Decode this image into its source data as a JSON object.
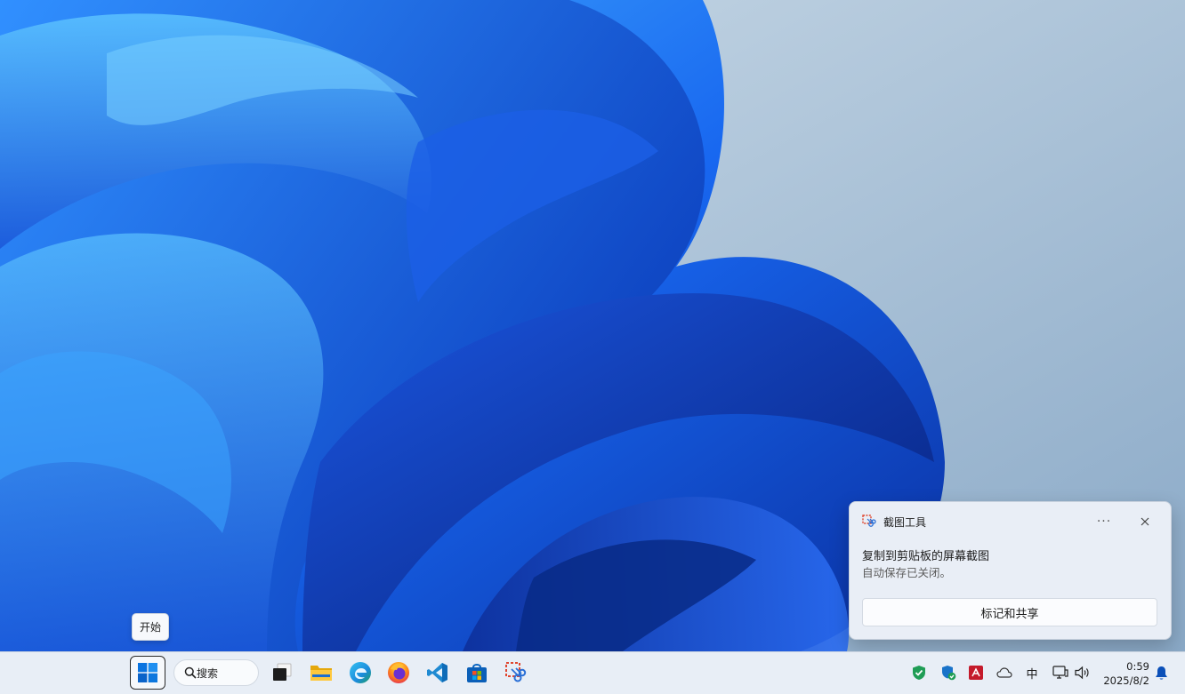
{
  "tooltip": {
    "start": "开始"
  },
  "toast": {
    "app_name": "截图工具",
    "more_label": "···",
    "title": "复制到剪贴板的屏幕截图",
    "body": "自动保存已关闭。",
    "action_label": "标记和共享"
  },
  "taskbar": {
    "search_label": "搜索",
    "apps": [
      "start-icon",
      "search",
      "task-view-icon",
      "file-explorer-icon",
      "edge-icon",
      "firefox-icon",
      "vscode-icon",
      "microsoft-store-icon",
      "snipping-tool-icon"
    ],
    "tray": {
      "input_method": "中",
      "time": "0:59",
      "date": "2025/8/2"
    }
  },
  "colors": {
    "accent": "#0a64d6",
    "taskbar_bg": "#e8eef6",
    "toast_bg": "#e9eef6"
  }
}
